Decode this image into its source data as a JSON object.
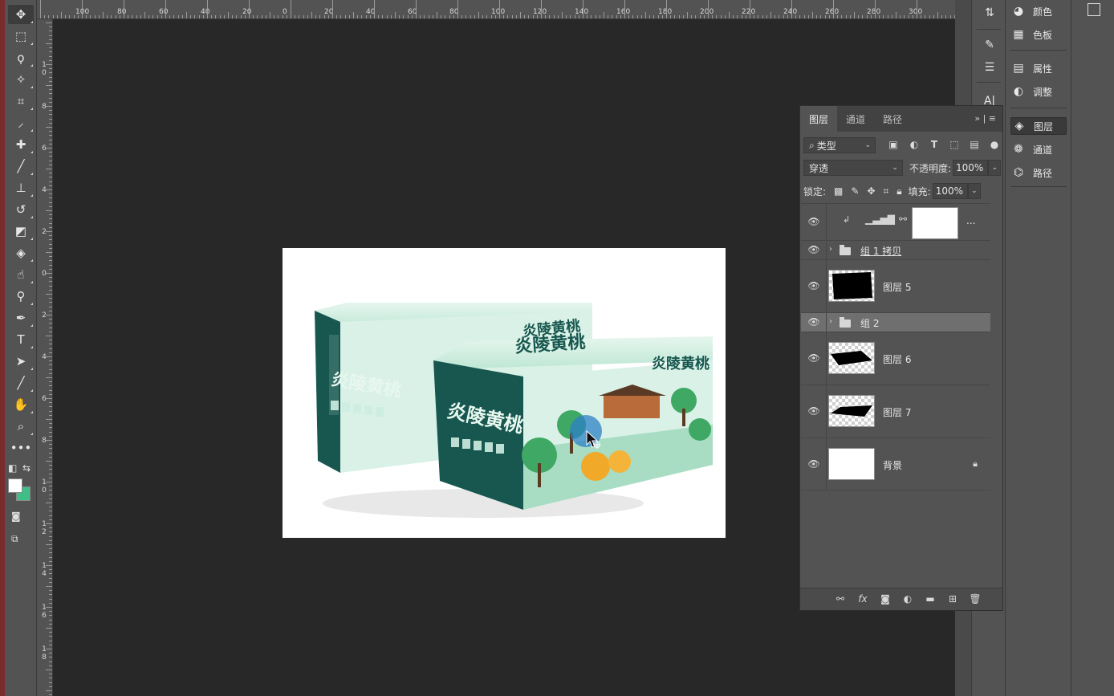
{
  "ruler_top_labels": [
    "100",
    "80",
    "60",
    "40",
    "20",
    "0",
    "20",
    "40",
    "60",
    "80",
    "100",
    "120",
    "140",
    "160",
    "180",
    "200",
    "220",
    "240",
    "260",
    "280",
    "300"
  ],
  "ruler_left_labels": [
    "10",
    "8",
    "6",
    "4",
    "2",
    "0",
    "2",
    "4",
    "6",
    "8",
    "10",
    "12",
    "14",
    "16",
    "18"
  ],
  "tools": [
    {
      "name": "move-tool-icon",
      "glyph": "✥"
    },
    {
      "name": "rectangular-marquee-tool-icon",
      "glyph": "⬚"
    },
    {
      "name": "lasso-tool-icon",
      "glyph": "ϙ"
    },
    {
      "name": "magic-wand-tool-icon",
      "glyph": "✧"
    },
    {
      "name": "crop-tool-icon",
      "glyph": "⌗"
    },
    {
      "name": "eyedropper-tool-icon",
      "glyph": "⸝"
    },
    {
      "name": "healing-brush-tool-icon",
      "glyph": "✚"
    },
    {
      "name": "brush-tool-icon",
      "glyph": "╱"
    },
    {
      "name": "clone-stamp-tool-icon",
      "glyph": "⊥"
    },
    {
      "name": "history-brush-tool-icon",
      "glyph": "↺"
    },
    {
      "name": "eraser-tool-icon",
      "glyph": "◩"
    },
    {
      "name": "paint-bucket-tool-icon",
      "glyph": "◈"
    },
    {
      "name": "smudge-tool-icon",
      "glyph": "☝"
    },
    {
      "name": "dodge-tool-icon",
      "glyph": "⚲"
    },
    {
      "name": "pen-tool-icon",
      "glyph": "✒"
    },
    {
      "name": "type-tool-icon",
      "glyph": "T"
    },
    {
      "name": "path-selection-tool-icon",
      "glyph": "➤"
    },
    {
      "name": "line-tool-icon",
      "glyph": "╱"
    },
    {
      "name": "hand-tool-icon",
      "glyph": "✋"
    },
    {
      "name": "zoom-tool-icon",
      "glyph": "⌕"
    },
    {
      "name": "more-tools-icon",
      "glyph": "•••"
    }
  ],
  "colors": {
    "foreground": "#ffffff",
    "background": "#3fbf87",
    "canvas_bg": "#282828",
    "panel": "#535353",
    "box_green": "#17574f",
    "box_mint": "#cfeee2",
    "selected_layer": "#6f6f6f"
  },
  "right_icons": [
    {
      "name": "history-icon",
      "glyph": "⇅"
    },
    {
      "name": "brush-settings-icon",
      "glyph": "✎"
    },
    {
      "name": "adjust-sliders-icon",
      "glyph": "☰"
    },
    {
      "name": "character-icon",
      "glyph": "A|"
    }
  ],
  "side_panels": [
    {
      "label": "颜色",
      "icon": "palette-icon",
      "glyph": "◕"
    },
    {
      "label": "色板",
      "icon": "swatches-icon",
      "glyph": "▦"
    },
    {
      "label": "属性",
      "icon": "properties-icon",
      "glyph": "▤"
    },
    {
      "label": "调整",
      "icon": "adjustments-icon",
      "glyph": "◐"
    },
    {
      "label": "图层",
      "icon": "layers-icon",
      "glyph": "◈"
    },
    {
      "label": "通道",
      "icon": "channels-icon",
      "glyph": "❁"
    },
    {
      "label": "路径",
      "icon": "paths-icon",
      "glyph": "⌬"
    }
  ],
  "layers_panel": {
    "tabs": [
      "图层",
      "通道",
      "路径"
    ],
    "active_tab": "图层",
    "filter_kind": "类型",
    "blend_mode": "穿透",
    "opacity_label": "不透明度:",
    "opacity_value": "100%",
    "lock_label": "锁定:",
    "fill_label": "填充:",
    "fill_value": "100%",
    "layers": [
      {
        "type": "adjustment",
        "name": "...",
        "visible": true
      },
      {
        "type": "group",
        "name": "组 1 拷贝",
        "visible": true
      },
      {
        "type": "layer",
        "name": "图层 5",
        "visible": true
      },
      {
        "type": "group",
        "name": "组 2",
        "visible": true,
        "selected": true
      },
      {
        "type": "layer",
        "name": "图层 6",
        "visible": true
      },
      {
        "type": "layer",
        "name": "图层 7",
        "visible": true
      },
      {
        "type": "background",
        "name": "背景",
        "visible": true,
        "locked": true
      }
    ]
  },
  "artwork": {
    "brand": "炎陵黄桃"
  }
}
